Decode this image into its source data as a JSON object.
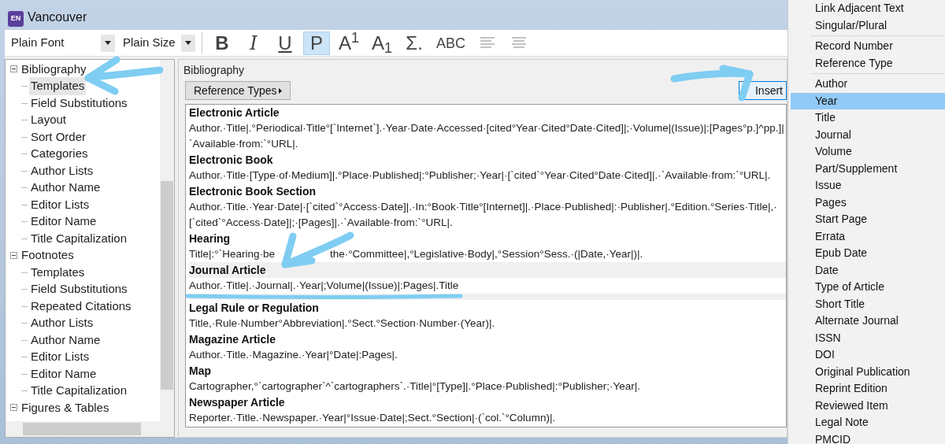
{
  "window": {
    "title": "Vancouver",
    "logo": "EN"
  },
  "toolbar": {
    "font": "Plain Font",
    "size": "Plain Size",
    "buttons": [
      {
        "label": "B",
        "kind": "bold",
        "selected": false
      },
      {
        "label": "I",
        "kind": "italic",
        "selected": false
      },
      {
        "label": "U",
        "kind": "underline",
        "selected": false
      },
      {
        "label": "P",
        "kind": "plain",
        "selected": true
      },
      {
        "label": "A$^{1}$",
        "kind": "rich",
        "selected": false
      },
      {
        "label": "A$_{1}$",
        "kind": "rich",
        "selected": false
      },
      {
        "label": "Σ.",
        "kind": "rich",
        "selected": false
      },
      {
        "label": "ABC",
        "kind": "smallcaps",
        "selected": false
      },
      {
        "kind": "align-left",
        "selected": false
      },
      {
        "kind": "align-center",
        "selected": false
      }
    ]
  },
  "tree": [
    {
      "label": "Bibliography",
      "expanded": true,
      "children": [
        {
          "label": "Templates",
          "selected": true
        },
        {
          "label": "Field Substitutions",
          "selected": false
        },
        {
          "label": "Layout",
          "selected": false
        },
        {
          "label": "Sort Order",
          "selected": false
        },
        {
          "label": "Categories",
          "selected": false
        },
        {
          "label": "Author Lists",
          "selected": false
        },
        {
          "label": "Author Name",
          "selected": false
        },
        {
          "label": "Editor Lists",
          "selected": false
        },
        {
          "label": "Editor Name",
          "selected": false
        },
        {
          "label": "Title Capitalization",
          "selected": false
        }
      ]
    },
    {
      "label": "Footnotes",
      "expanded": true,
      "children": [
        {
          "label": "Templates",
          "selected": false
        },
        {
          "label": "Field Substitutions",
          "selected": false
        },
        {
          "label": "Repeated Citations",
          "selected": false
        },
        {
          "label": "Author Lists",
          "selected": false
        },
        {
          "label": "Author Name",
          "selected": false
        },
        {
          "label": "Editor Lists",
          "selected": false
        },
        {
          "label": "Editor Name",
          "selected": false
        },
        {
          "label": "Title Capitalization",
          "selected": false
        }
      ]
    },
    {
      "label": "Figures & Tables",
      "expanded": true
    }
  ],
  "pane": {
    "title": "Bibliography",
    "reference_types_button": "Reference Types",
    "insert_button": "Insert"
  },
  "templates": [
    {
      "type": "Electronic Article",
      "selected": false,
      "lines": [
        [
          "Author.·Title|.°Periodical·Title°[`Internet`].·Year·Date·Accessed·[cited°Year·Cited°Date·Cited]|;·Volume|(Issue)|:[Pages°p.]^pp.]|"
        ],
        [
          "`Available·from:`°URL|."
        ]
      ]
    },
    {
      "type": "Electronic Book",
      "selected": false,
      "lines": [
        [
          "Author.·Title·[Type·of·Medium]|.°Place·Published|:°Publisher;·Year|·[`cited`°Year·Cited°Date·Cited]|.·`Available·from:`°URL|."
        ]
      ]
    },
    {
      "type": "Electronic Book Section",
      "selected": false,
      "lines": [
        [
          "Author.·Title.·Year·Date|·[`cited`°Access·Date]|.·In:°Book·Title°[Internet]|.·Place·Published|:·Publisher|.°Edition.°Series·Title|,·"
        ],
        [
          "[`cited`°Access·Date]|;·[Pages]|.·`Available·from:`°URL|."
        ]
      ]
    },
    {
      "type": "Hearing",
      "selected": false,
      "lines": [
        [
          "Title|:°`Hearing·be",
          "the·°Committee|,°Legislative·Body|,°Session°Sess.·(|Date,·Year|)|."
        ]
      ]
    },
    {
      "type": "Journal Article",
      "selected": true,
      "lines": [
        [
          "Author.·Title|.·Journal|.·Year|;Volume|(Issue)|:Pages|.Title"
        ]
      ]
    },
    {
      "type": "Legal Rule or Regulation",
      "selected": false,
      "lines": [
        [
          "Title,·Rule·Number°Abbreviation|.°Sect.°Section·Number·(Year)|."
        ]
      ]
    },
    {
      "type": "Magazine Article",
      "selected": false,
      "lines": [
        [
          "Author.·Title.·Magazine.·Year|°Date|:Pages|."
        ]
      ]
    },
    {
      "type": "Map",
      "selected": false,
      "lines": [
        [
          "Cartographer,°`cartographer`^`cartographers`.·Title|°[Type]|.°Place·Published|:°Publisher;·Year|."
        ]
      ]
    },
    {
      "type": "Newspaper Article",
      "selected": false,
      "lines": [
        [
          "Reporter.·Title.·Newspaper.·Year|°Issue·Date|;Sect.°Section|·(`col.`°Column)|."
        ]
      ]
    }
  ],
  "field_menu": [
    {
      "kind": "item",
      "label": "Link Adjacent Text",
      "selected": false
    },
    {
      "kind": "item",
      "label": "Singular/Plural",
      "selected": false
    },
    {
      "kind": "separator"
    },
    {
      "kind": "item",
      "label": "Record Number",
      "selected": false
    },
    {
      "kind": "item",
      "label": "Reference Type",
      "selected": false
    },
    {
      "kind": "separator"
    },
    {
      "kind": "item",
      "label": "Author",
      "selected": false
    },
    {
      "kind": "item",
      "label": "Year",
      "selected": true
    },
    {
      "kind": "item",
      "label": "Title",
      "selected": false
    },
    {
      "kind": "item",
      "label": "Journal",
      "selected": false
    },
    {
      "kind": "item",
      "label": "Volume",
      "selected": false
    },
    {
      "kind": "item",
      "label": "Part/Supplement",
      "selected": false
    },
    {
      "kind": "item",
      "label": "Issue",
      "selected": false
    },
    {
      "kind": "item",
      "label": "Pages",
      "selected": false
    },
    {
      "kind": "item",
      "label": "Start Page",
      "selected": false
    },
    {
      "kind": "item",
      "label": "Errata",
      "selected": false
    },
    {
      "kind": "item",
      "label": "Epub Date",
      "selected": false
    },
    {
      "kind": "item",
      "label": "Date",
      "selected": false
    },
    {
      "kind": "item",
      "label": "Type of Article",
      "selected": false
    },
    {
      "kind": "item",
      "label": "Short Title",
      "selected": false
    },
    {
      "kind": "item",
      "label": "Alternate Journal",
      "selected": false
    },
    {
      "kind": "item",
      "label": "ISSN",
      "selected": false
    },
    {
      "kind": "item",
      "label": "DOI",
      "selected": false
    },
    {
      "kind": "item",
      "label": "Original Publication",
      "selected": false
    },
    {
      "kind": "item",
      "label": "Reprint Edition",
      "selected": false
    },
    {
      "kind": "item",
      "label": "Reviewed Item",
      "selected": false
    },
    {
      "kind": "item",
      "label": "Legal Note",
      "selected": false
    },
    {
      "kind": "item",
      "label": "PMCID",
      "selected": false
    }
  ]
}
